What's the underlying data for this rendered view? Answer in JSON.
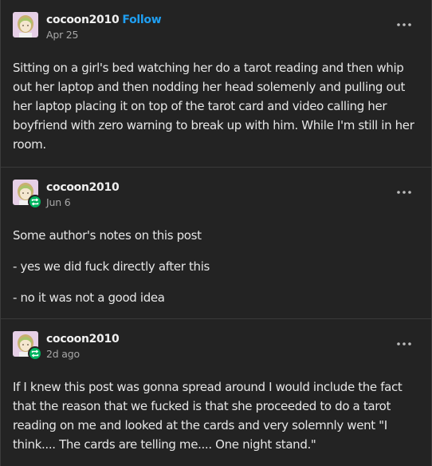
{
  "posts": [
    {
      "username": "cocoon2010",
      "follow_label": "Follow",
      "date": "Apr 25",
      "paragraphs": [
        "Sitting on a girl's bed watching her do a tarot reading and then whip out her laptop and then nodding her head solemenly and pulling out her laptop placing it on top of the tarot card and video calling her boyfriend with zero warning to break up with him. While I'm still in her room."
      ]
    },
    {
      "username": "cocoon2010",
      "date": "Jun 6",
      "reblog_badge": "reblog-icon",
      "paragraphs": [
        "Some author's notes on this post",
        "- yes we did fuck directly after this",
        "- no it was not a good idea"
      ]
    },
    {
      "username": "cocoon2010",
      "date": "2d ago",
      "reblog_badge": "reblog-icon",
      "paragraphs": [
        "If I knew this post was gonna spread around I would include the fact that the reason that we fucked is that she proceeded to do a tarot reading on me and looked at the cards and very solemnly went \"I think.... The cards are telling me.... One night stand.\""
      ]
    }
  ],
  "icons": {
    "more": "more-options-icon",
    "avatar": "avatar-image",
    "reblog": "reblog-icon"
  },
  "colors": {
    "background": "#232323",
    "follow": "#1f9ff2",
    "reblog_badge": "#00b35f",
    "avatar_bg": "#e6cfe6"
  }
}
